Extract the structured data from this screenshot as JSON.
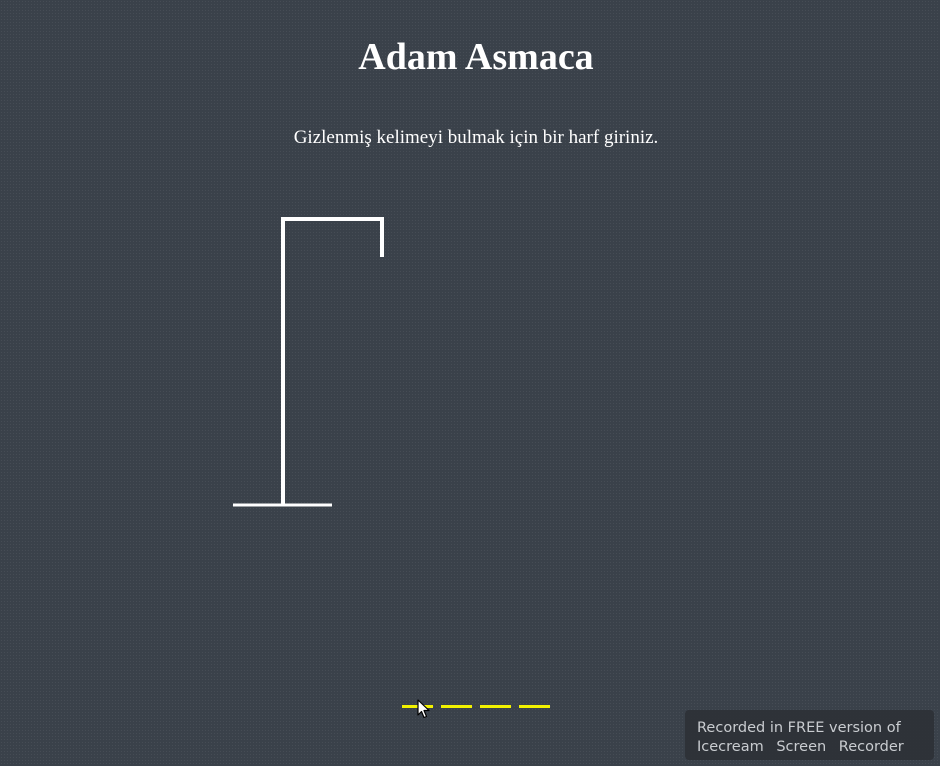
{
  "game": {
    "title": "Adam Asmaca",
    "instructions": "Gizlenmiş kelimeyi bulmak için bir harf giriniz.",
    "word": {
      "letter_count": 4,
      "revealed_letters": [
        "",
        "",
        "",
        ""
      ]
    },
    "wrong_guesses": 0
  },
  "colors": {
    "background": "#3a414a",
    "text": "#ffffff",
    "gallows": "#ffffff",
    "word_slot": "#f2f200"
  },
  "icons": {
    "pointer": "mouse-pointer-icon"
  },
  "watermark": {
    "line1": "Recorded in FREE version of",
    "line2": "Icecream Screen Recorder"
  }
}
